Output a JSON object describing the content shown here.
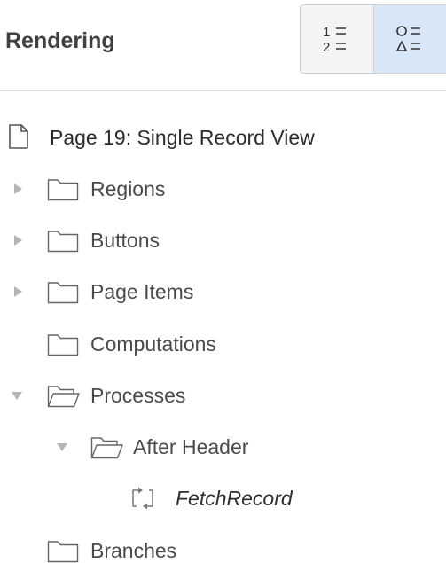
{
  "header": {
    "title": "Rendering",
    "view_buttons": [
      {
        "icon": "ordered-list-icon",
        "state": "inactive"
      },
      {
        "icon": "component-list-icon",
        "state": "active"
      }
    ]
  },
  "tree": {
    "page": {
      "label": "Page 19: Single Record View",
      "icon": "page-icon"
    },
    "nodes": [
      {
        "label": "Regions",
        "icon": "folder-icon",
        "expander": "collapsed"
      },
      {
        "label": "Buttons",
        "icon": "folder-icon",
        "expander": "collapsed"
      },
      {
        "label": "Page Items",
        "icon": "folder-icon",
        "expander": "collapsed"
      },
      {
        "label": "Computations",
        "icon": "folder-icon",
        "expander": "none"
      },
      {
        "label": "Processes",
        "icon": "folder-open-icon",
        "expander": "expanded"
      },
      {
        "label": "After Header",
        "icon": "folder-open-icon",
        "expander": "expanded"
      },
      {
        "label": "FetchRecord",
        "icon": "process-icon",
        "expander": "none"
      },
      {
        "label": "Branches",
        "icon": "folder-icon",
        "expander": "none"
      }
    ]
  }
}
